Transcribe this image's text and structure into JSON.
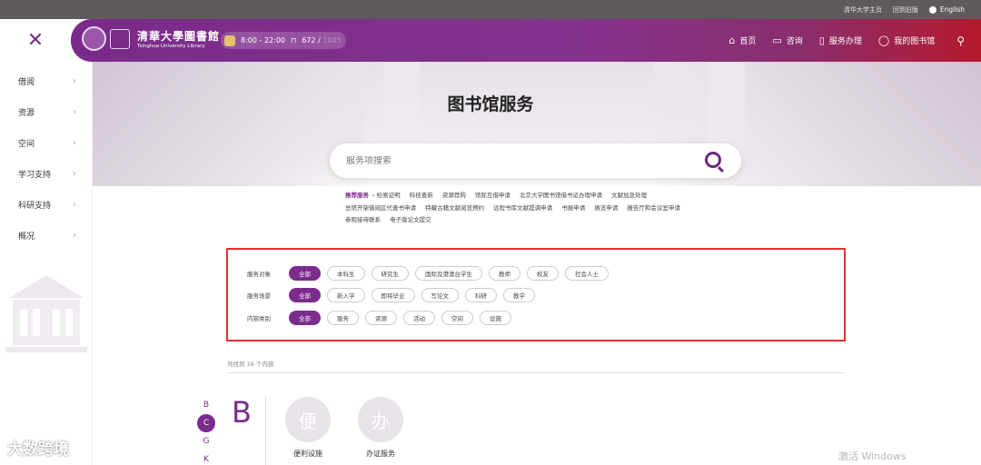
{
  "top_links": [
    "清华大学主页",
    "回到旧版"
  ],
  "language_label": "English",
  "left_menu": [
    {
      "label": "借阅"
    },
    {
      "label": "资源"
    },
    {
      "label": "空间"
    },
    {
      "label": "学习支持"
    },
    {
      "label": "科研支持"
    },
    {
      "label": "概况"
    }
  ],
  "header": {
    "logo_cn": "清華大學圖書館",
    "logo_en": "Tsinghua University Library",
    "hours": "8:00 - 22:00",
    "seats_used": "672",
    "seats_sep": "/",
    "seats_total": "1845",
    "nav": [
      {
        "label": "首页",
        "icon": "home-icon"
      },
      {
        "label": "咨询",
        "icon": "chat-icon"
      },
      {
        "label": "服务办理",
        "icon": "book-icon"
      },
      {
        "label": "我的图书馆",
        "icon": "user-icon"
      }
    ]
  },
  "page_title": "图书馆服务",
  "search": {
    "placeholder": "服务项搜索"
  },
  "recommended": {
    "label": "推荐服务",
    "items": [
      "检索证明",
      "科技查新",
      "资源荐购",
      "馆际互借申请",
      "北京大学图书馆借书证办理申请",
      "文献加急处理",
      "总馆开架借阅区代查书申请",
      "特藏古籍文献阅览预约",
      "远程书库文献提调申请",
      "书展申请",
      "展览申请",
      "报告厅和会议室申请",
      "参观接待联系",
      "电子版论文提交"
    ]
  },
  "filters": [
    {
      "label": "服务对象",
      "options": [
        "全部",
        "本科生",
        "研究生",
        "国际及港澳台学生",
        "教师",
        "校友",
        "社会人士"
      ]
    },
    {
      "label": "服务场景",
      "options": [
        "全部",
        "新入学",
        "即将毕业",
        "写论文",
        "科研",
        "教学"
      ]
    },
    {
      "label": "内容类别",
      "options": [
        "全部",
        "服务",
        "资源",
        "活动",
        "空间",
        "设施"
      ]
    }
  ],
  "result_count_text": "共找到 16 个内容",
  "alpha_index": [
    "B",
    "C",
    "G",
    "K"
  ],
  "alpha_current": "C",
  "section_letter": "B",
  "services": [
    {
      "glyph": "便",
      "label": "便利设施"
    },
    {
      "glyph": "办",
      "label": "办证服务"
    }
  ],
  "windows_watermark": "激活 Windows",
  "corner_logo": "大数跨境",
  "colors": {
    "brand_purple": "#7b2c8d",
    "header_red": "#b5192e",
    "highlight_border": "#e53030"
  }
}
